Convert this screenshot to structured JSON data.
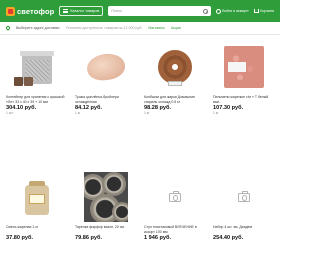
{
  "header": {
    "logo_text": "светофор",
    "catalog_label": "Каталог товаров",
    "search_placeholder": "Поиск",
    "login_label": "Войти в аккаунт",
    "cart_label": "Корзина"
  },
  "subbar": {
    "address_label": "Выберите адрес доставки",
    "address_note": "Уточняем доступность товаров на 12 000 руб.",
    "links": [
      "Магазины",
      "Акции"
    ]
  },
  "products": [
    {
      "name": "Контейнер для хранения с крышкой «Ле» 33 x 40 x 39 + 10 мм",
      "price": "304.10 руб.",
      "unit": "1 шт"
    },
    {
      "name": "Тушка цыплёнка-бройлера охлаждённая",
      "price": "84.12 руб.",
      "unit": "1 кг"
    },
    {
      "name": "Колбаски для жарки Домашние спираль охлажд 0.5 кг",
      "price": "98.28 руб.",
      "unit": "1 кг"
    },
    {
      "name": "Пельмени жареные т/м « Т белый вып.",
      "price": "107.30 руб.",
      "unit": "1 кг"
    },
    {
      "name": "Смесь жареная 1 кг",
      "price": "37.80 руб.",
      "unit": ""
    },
    {
      "name": "Тарелка фарфор вазон, 20 см.",
      "price": "79.86 руб.",
      "unit": ""
    },
    {
      "name": "Стул пластиковый ВЛЕЧЕНИЕ в ассорт 100 мм",
      "price": "1 946 руб.",
      "unit": ""
    },
    {
      "name": "Набор 4 шт. эм. Диадем",
      "price": "254.40 руб.",
      "unit": ""
    }
  ],
  "colors": {
    "brand_green": "#2e9d3a",
    "logo_orange": "#f5a623",
    "logo_red": "#e53935"
  }
}
